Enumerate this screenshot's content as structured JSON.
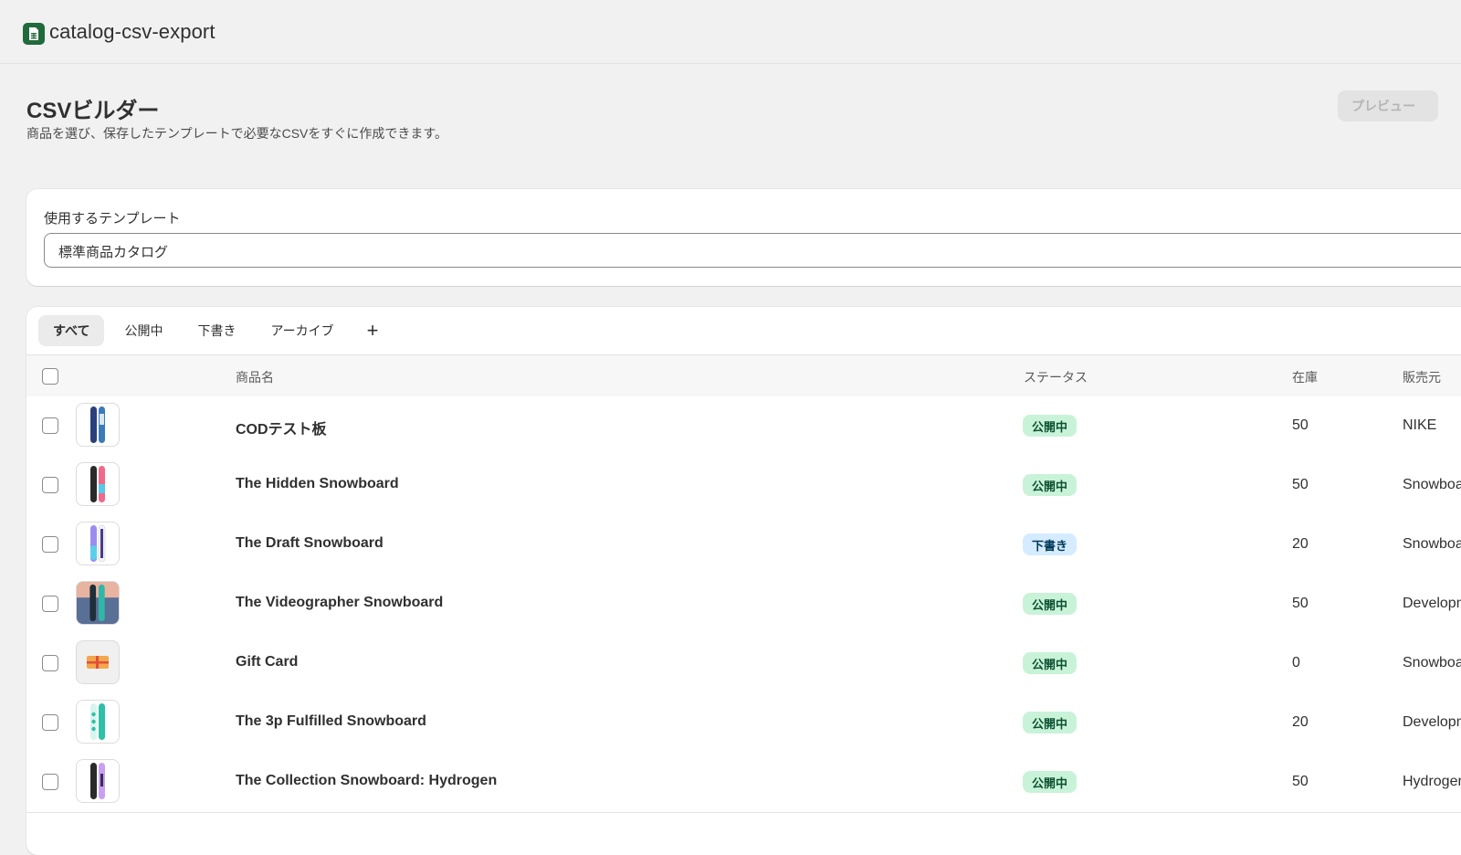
{
  "app": {
    "name": "catalog-csv-export",
    "icon": "spreadsheet-icon"
  },
  "page": {
    "title": "CSVビルダー",
    "subtitle": "商品を選び、保存したテンプレートで必要なCSVをすぐに作成できます。",
    "preview_button": "プレビュー"
  },
  "template": {
    "label": "使用するテンプレート",
    "selected": "標準商品カタログ"
  },
  "tabs": {
    "all": "すべて",
    "active": "公開中",
    "draft": "下書き",
    "archived": "アーカイブ",
    "add": "+"
  },
  "table": {
    "columns": {
      "name": "商品名",
      "status": "ステータス",
      "inventory": "在庫",
      "vendor": "販売元"
    },
    "rows": [
      {
        "name": "CODテスト板",
        "status": "公開中",
        "inventory": "50",
        "vendor": "NIKE"
      },
      {
        "name": "The Hidden Snowboard",
        "status": "公開中",
        "inventory": "50",
        "vendor": "Snowboard Vendor"
      },
      {
        "name": "The Draft Snowboard",
        "status": "下書き",
        "inventory": "20",
        "vendor": "Snowboard Vendor"
      },
      {
        "name": "The Videographer Snowboard",
        "status": "公開中",
        "inventory": "50",
        "vendor": "Development"
      },
      {
        "name": "Gift Card",
        "status": "公開中",
        "inventory": "0",
        "vendor": "Snowboard Vendor"
      },
      {
        "name": "The 3p Fulfilled Snowboard",
        "status": "公開中",
        "inventory": "20",
        "vendor": "Development"
      },
      {
        "name": "The Collection Snowboard: Hydrogen",
        "status": "公開中",
        "inventory": "50",
        "vendor": "Hydrogen Vendor"
      }
    ]
  },
  "colors": {
    "active_badge_bg": "#c9f3d8",
    "draft_badge_bg": "#d5ebff",
    "app_icon": "#1f6b3c"
  }
}
